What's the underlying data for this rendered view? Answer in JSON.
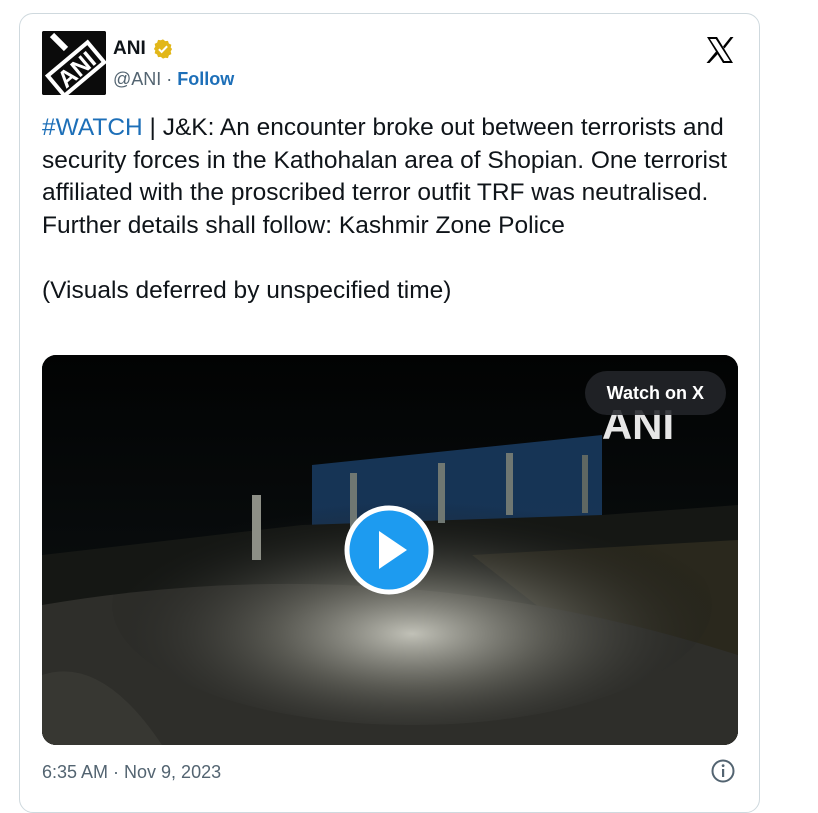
{
  "tweet": {
    "author_name": "ANI",
    "handle": "@ANI",
    "separator": " · ",
    "follow_label": "Follow",
    "hashtag": "#WATCH",
    "body": " | J&K: An encounter broke out between terrorists and security forces in the Kathohalan area of Shopian. One terrorist affiliated with the proscribed terror outfit TRF was neutralised. Further details shall follow: Kashmir Zone Police\n\n(Visuals deferred by unspecified time)",
    "timestamp": "6:35 AM · Nov 9, 2023"
  },
  "media": {
    "watch_label": "Watch on X",
    "watermark": "ANI",
    "avatar_text": "ANI"
  },
  "colors": {
    "link": "#1d6fb8",
    "verified_gold": "#e2b719",
    "play_blue": "#1d9bf0"
  },
  "icons": [
    "verified-badge-icon",
    "x-logo-icon",
    "play-icon",
    "info-icon"
  ]
}
